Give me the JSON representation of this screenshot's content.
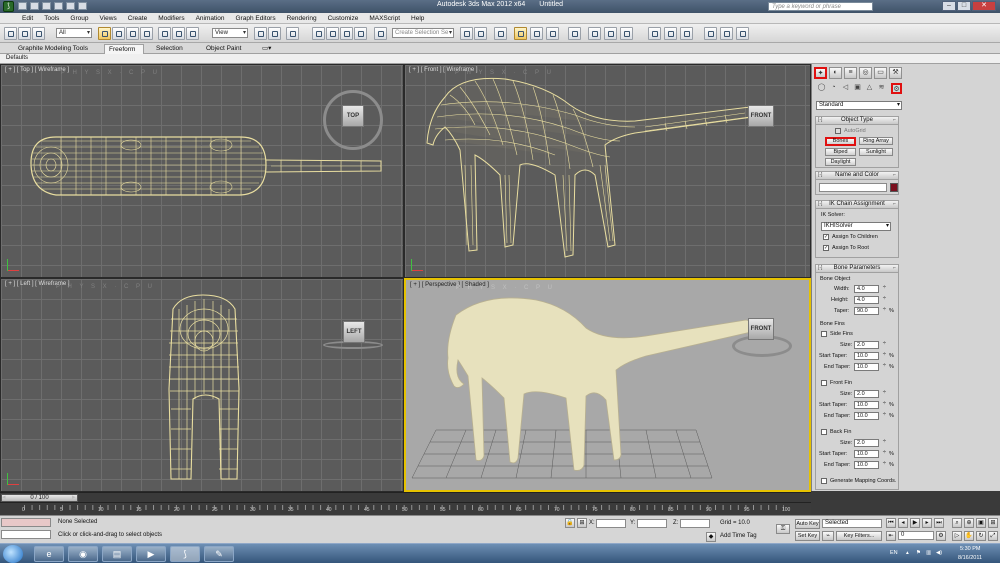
{
  "titlebar": {
    "app_title": "Autodesk 3ds Max  2012 x64",
    "document": "Untitled",
    "search_placeholder": "Type a keyword or phrase"
  },
  "menu": [
    "Edit",
    "Tools",
    "Group",
    "Views",
    "Create",
    "Modifiers",
    "Animation",
    "Graph Editors",
    "Rendering",
    "Customize",
    "MAXScript",
    "Help"
  ],
  "toolbar": {
    "selection_filter": "All",
    "reference_coord": "View",
    "named_selection_placeholder": "Create Selection Se"
  },
  "ribbon": {
    "tabs": [
      "Graphite Modeling Tools",
      "Freeform",
      "Selection",
      "Object Paint"
    ],
    "active_tab": "Freeform",
    "panel_label": "Defaults"
  },
  "viewports": {
    "top": {
      "label": "[ + ] [ Top ] [ Wireframe ]",
      "cube": "TOP"
    },
    "front": {
      "label": "[ + ] [ Front ] [ Wireframe ]",
      "cube": "FRONT"
    },
    "left": {
      "label": "[ + ] [ Left ] [ Wireframe ]",
      "cube": "LEFT"
    },
    "perspective": {
      "label": "[ + ] [ Perspective ] [ Shaded ]",
      "cube": "FRONT"
    },
    "watermark": "P H Y S X · C P U"
  },
  "command_panel": {
    "category": "Standard",
    "object_type": {
      "title": "Object Type",
      "autogrid": "AutoGrid",
      "buttons": [
        "Bones",
        "Ring Array",
        "Biped",
        "Sunlight",
        "Daylight"
      ]
    },
    "name_and_color": {
      "title": "Name and Color",
      "name_value": "",
      "color": "#7a0f1e"
    },
    "ik_chain": {
      "title": "IK Chain Assignment",
      "solver_label": "IK Solver:",
      "solver_value": "IKHISolver",
      "assign_children": "Assign To Children",
      "assign_root": "Assign To Root"
    },
    "bone_parameters": {
      "title": "Bone Parameters",
      "bone_object": "Bone Object",
      "width_label": "Width:",
      "width": "4.0",
      "height_label": "Height:",
      "height": "4.0",
      "taper_label": "Taper:",
      "taper": "90.0",
      "pct": "%",
      "bone_fins": "Bone Fins",
      "side_fins": "Side Fins",
      "front_fin": "Front Fin",
      "back_fin": "Back Fin",
      "size_label": "Size:",
      "size": "2.0",
      "start_taper_label": "Start Taper:",
      "start_taper": "10.0",
      "end_taper_label": "End Taper:",
      "end_taper": "10.0",
      "gen_mapping": "Generate Mapping Coords."
    }
  },
  "timeline": {
    "slider": "0 / 100",
    "ticks": [
      "0",
      "5",
      "10",
      "15",
      "20",
      "25",
      "30",
      "35",
      "40",
      "45",
      "50",
      "55",
      "60",
      "65",
      "70",
      "75",
      "80",
      "85",
      "90",
      "95",
      "100"
    ]
  },
  "status": {
    "selection": "None Selected",
    "prompt": "Click or click-and-drag to select objects",
    "x_label": "X:",
    "y_label": "Y:",
    "z_label": "Z:",
    "grid": "Grid = 10.0",
    "add_time_tag": "Add Time Tag",
    "auto_key": "Auto Key",
    "set_key": "Set Key",
    "key_mode": "Selected",
    "key_filters": "Key Filters...",
    "frame": "0"
  },
  "taskbar": {
    "lang": "EN",
    "time": "5:30 PM",
    "date": "8/16/2011"
  },
  "colors": {
    "mesh": "#e9dea0",
    "active_border": "#e6c200",
    "highlight": "#e01010",
    "shaded_model": "#e7e1bd"
  }
}
